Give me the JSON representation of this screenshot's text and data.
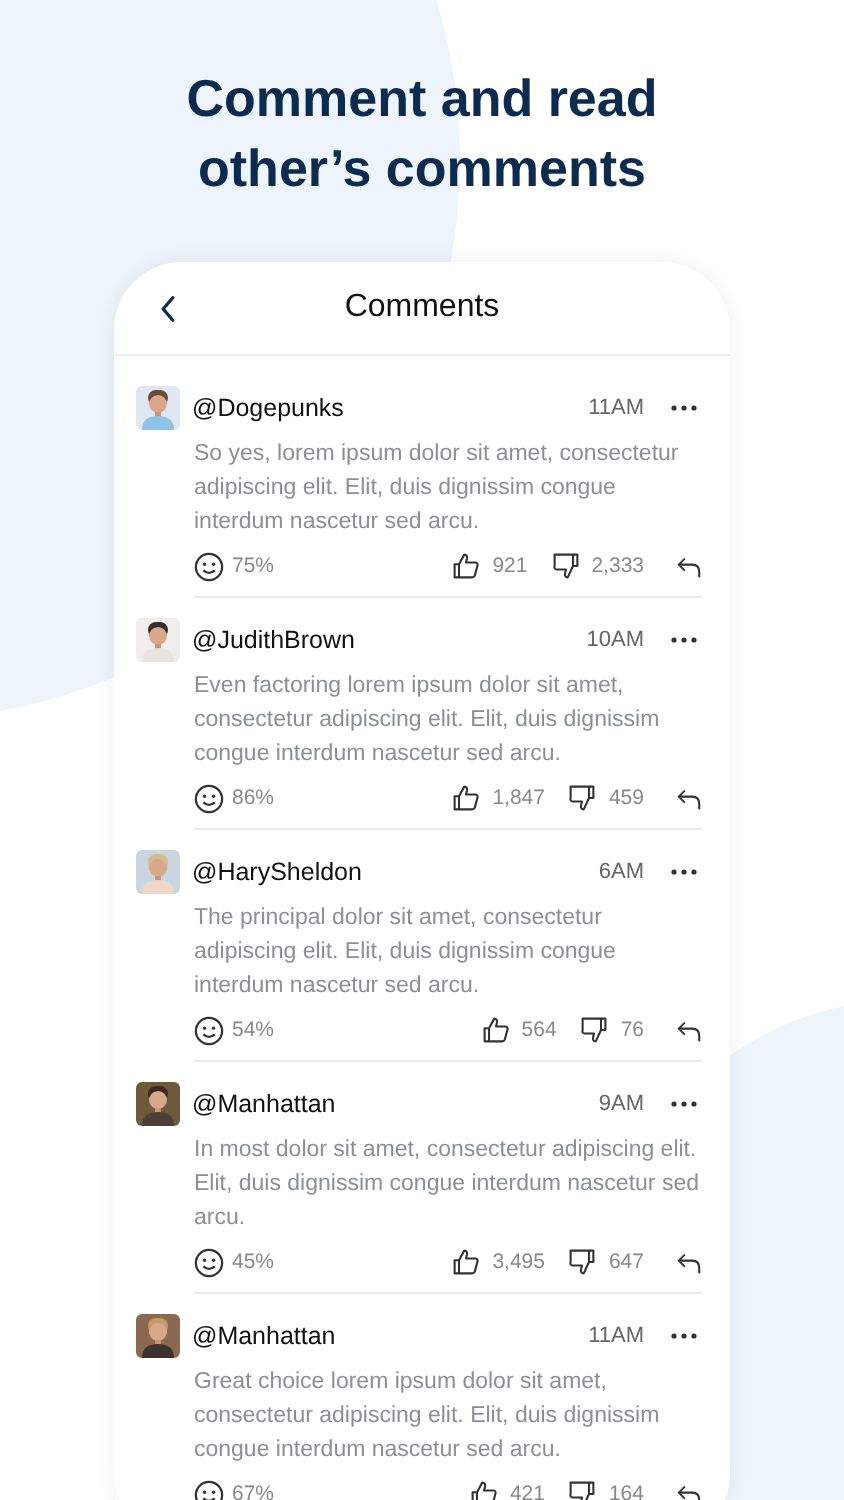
{
  "headline": "Comment and read other’s comments",
  "screen": {
    "title": "Comments"
  },
  "comments": [
    {
      "user": "@Dogepunks",
      "time": "11AM",
      "text": "So yes, lorem ipsum dolor sit amet, consectetur adipiscing elit. Elit, duis dignissim congue interdum nascetur sed arcu.",
      "score": "75%",
      "likes": "921",
      "dislikes": "2,333"
    },
    {
      "user": "@JudithBrown",
      "time": "10AM",
      "text": "Even factoring lorem ipsum dolor sit amet, consectetur adipiscing elit. Elit, duis dignissim congue interdum nascetur sed arcu.",
      "score": "86%",
      "likes": "1,847",
      "dislikes": "459"
    },
    {
      "user": "@HarySheldon",
      "time": "6AM",
      "text": "The principal dolor sit amet, consectetur adipiscing elit. Elit, duis dignissim congue interdum nascetur sed arcu.",
      "score": "54%",
      "likes": "564",
      "dislikes": "76"
    },
    {
      "user": "@Manhattan",
      "time": "9AM",
      "text": "In most dolor sit amet, consectetur adipiscing elit. Elit, duis dignissim congue interdum nascetur sed arcu.",
      "score": "45%",
      "likes": "3,495",
      "dislikes": "647"
    },
    {
      "user": "@Manhattan",
      "time": "11AM",
      "text": "Great choice lorem ipsum dolor sit amet, consectetur adipiscing elit. Elit, duis dignissim congue interdum nascetur sed arcu.",
      "score": "67%",
      "likes": "421",
      "dislikes": "164"
    }
  ]
}
